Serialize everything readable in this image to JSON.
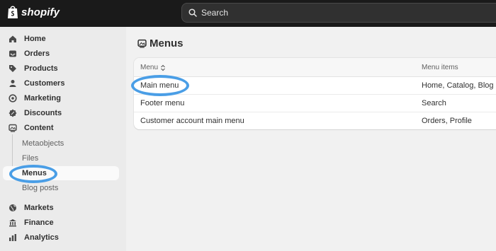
{
  "topbar": {
    "brand": "shopify",
    "search_placeholder": "Search"
  },
  "sidebar": {
    "items": [
      {
        "label": "Home",
        "icon": "home-icon"
      },
      {
        "label": "Orders",
        "icon": "inbox-icon"
      },
      {
        "label": "Products",
        "icon": "tag-icon"
      },
      {
        "label": "Customers",
        "icon": "person-icon"
      },
      {
        "label": "Marketing",
        "icon": "target-icon"
      },
      {
        "label": "Discounts",
        "icon": "discount-icon"
      },
      {
        "label": "Content",
        "icon": "content-icon"
      }
    ],
    "content_sub": [
      "Metaobjects",
      "Files",
      "Menus",
      "Blog posts"
    ],
    "bottom_items": [
      {
        "label": "Markets",
        "icon": "globe-icon"
      },
      {
        "label": "Finance",
        "icon": "bank-icon"
      },
      {
        "label": "Analytics",
        "icon": "bar-chart-icon"
      }
    ]
  },
  "main": {
    "title": "Menus",
    "columns": [
      "Menu",
      "Menu items"
    ],
    "rows": [
      {
        "menu": "Main menu",
        "items": "Home, Catalog, Blog"
      },
      {
        "menu": "Footer menu",
        "items": "Search"
      },
      {
        "menu": "Customer account main menu",
        "items": "Orders, Profile"
      }
    ]
  },
  "colors": {
    "topbar": "#1a1a1a",
    "sidebar": "#ebebeb",
    "highlight": "#4a9ee6"
  }
}
